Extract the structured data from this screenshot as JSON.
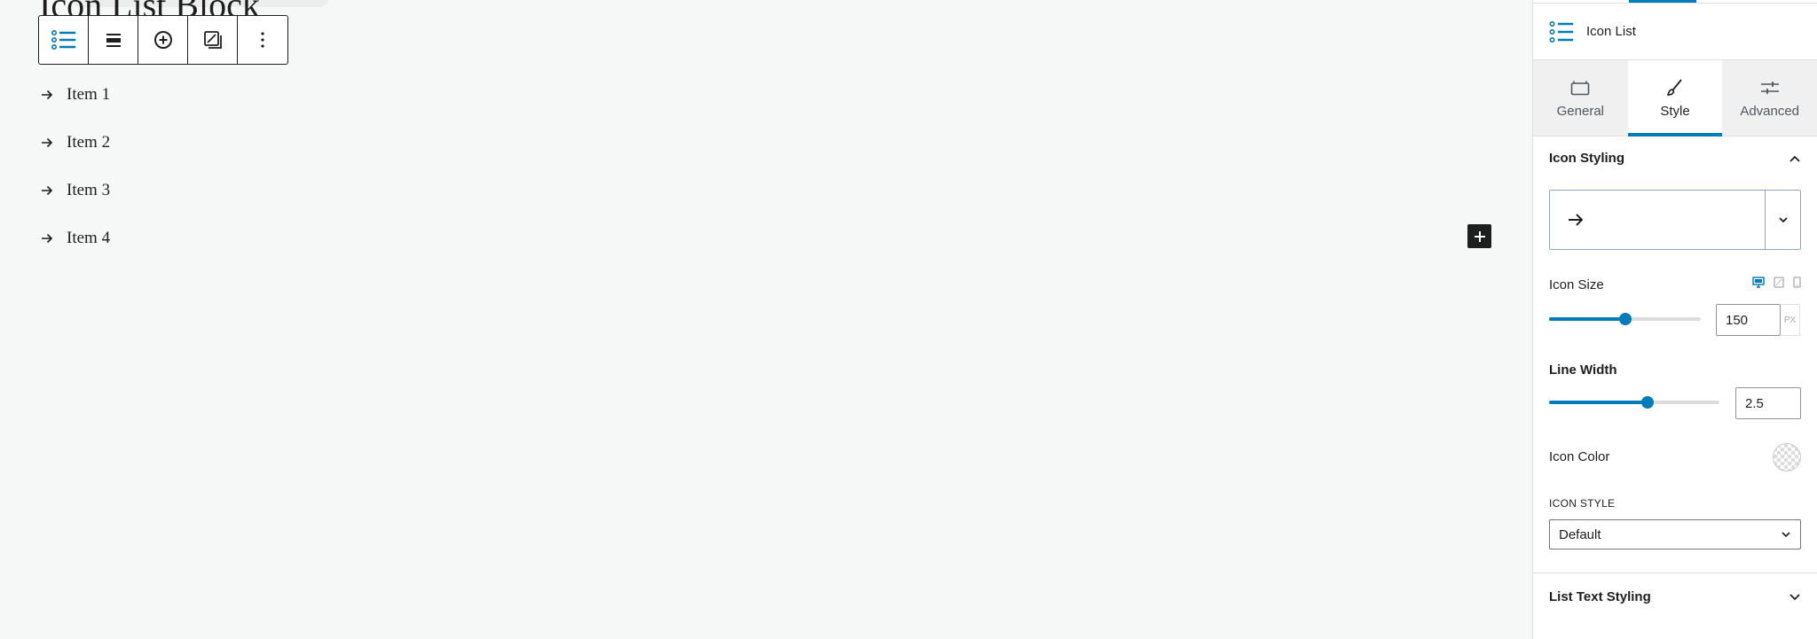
{
  "canvas": {
    "block_title": "Icon List Block",
    "toolbar": {
      "icons": [
        "icon-list-icon",
        "align-icon",
        "add-icon",
        "transform-icon",
        "more-options-icon"
      ]
    },
    "list_items": [
      {
        "label": "Item 1",
        "icon": "arrow-right-icon"
      },
      {
        "label": "Item 2",
        "icon": "arrow-right-icon"
      },
      {
        "label": "Item 3",
        "icon": "arrow-right-icon"
      },
      {
        "label": "Item 4",
        "icon": "arrow-right-icon"
      }
    ]
  },
  "sidebar": {
    "block_name": "Icon List",
    "tabs": [
      {
        "label": "General",
        "icon": "briefcase-icon",
        "active": false
      },
      {
        "label": "Style",
        "icon": "brush-icon",
        "active": true
      },
      {
        "label": "Advanced",
        "icon": "sliders-icon",
        "active": false
      }
    ],
    "icon_styling": {
      "title": "Icon Styling",
      "selected_icon": "arrow-right-icon",
      "icon_size": {
        "label": "Icon Size",
        "value": "150",
        "unit": "PX",
        "level": 0.5
      },
      "line_width": {
        "label": "Line Width",
        "value": "2.5",
        "level": 0.58
      },
      "icon_color": {
        "label": "Icon Color"
      },
      "icon_style": {
        "label": "ICON STYLE",
        "value": "Default"
      }
    },
    "list_text_styling": {
      "title": "List Text Styling"
    }
  },
  "colors": {
    "accent": "#007cba",
    "text": "#1e1e1e",
    "canvas_bg": "#f6f8f8"
  }
}
